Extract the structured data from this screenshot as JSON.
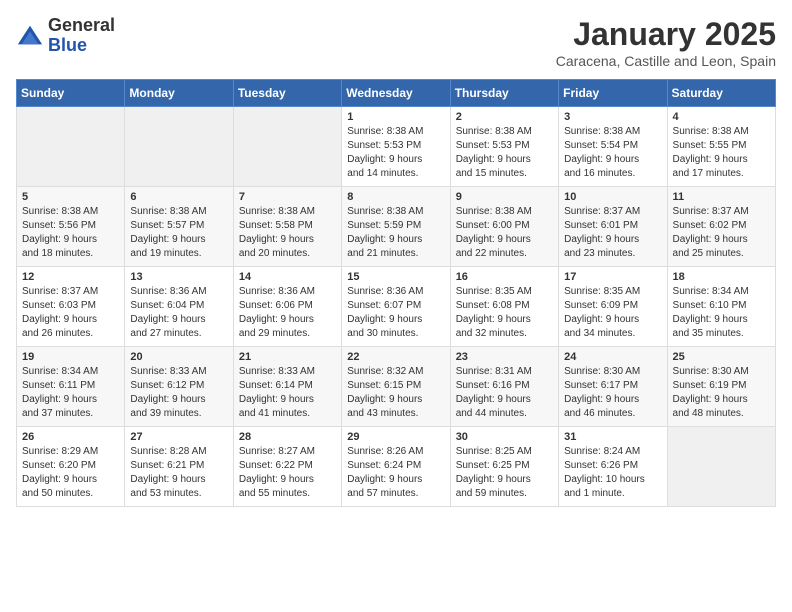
{
  "header": {
    "logo_general": "General",
    "logo_blue": "Blue",
    "month": "January 2025",
    "location": "Caracena, Castille and Leon, Spain"
  },
  "weekdays": [
    "Sunday",
    "Monday",
    "Tuesday",
    "Wednesday",
    "Thursday",
    "Friday",
    "Saturday"
  ],
  "weeks": [
    [
      {
        "day": "",
        "info": ""
      },
      {
        "day": "",
        "info": ""
      },
      {
        "day": "",
        "info": ""
      },
      {
        "day": "1",
        "info": "Sunrise: 8:38 AM\nSunset: 5:53 PM\nDaylight: 9 hours\nand 14 minutes."
      },
      {
        "day": "2",
        "info": "Sunrise: 8:38 AM\nSunset: 5:53 PM\nDaylight: 9 hours\nand 15 minutes."
      },
      {
        "day": "3",
        "info": "Sunrise: 8:38 AM\nSunset: 5:54 PM\nDaylight: 9 hours\nand 16 minutes."
      },
      {
        "day": "4",
        "info": "Sunrise: 8:38 AM\nSunset: 5:55 PM\nDaylight: 9 hours\nand 17 minutes."
      }
    ],
    [
      {
        "day": "5",
        "info": "Sunrise: 8:38 AM\nSunset: 5:56 PM\nDaylight: 9 hours\nand 18 minutes."
      },
      {
        "day": "6",
        "info": "Sunrise: 8:38 AM\nSunset: 5:57 PM\nDaylight: 9 hours\nand 19 minutes."
      },
      {
        "day": "7",
        "info": "Sunrise: 8:38 AM\nSunset: 5:58 PM\nDaylight: 9 hours\nand 20 minutes."
      },
      {
        "day": "8",
        "info": "Sunrise: 8:38 AM\nSunset: 5:59 PM\nDaylight: 9 hours\nand 21 minutes."
      },
      {
        "day": "9",
        "info": "Sunrise: 8:38 AM\nSunset: 6:00 PM\nDaylight: 9 hours\nand 22 minutes."
      },
      {
        "day": "10",
        "info": "Sunrise: 8:37 AM\nSunset: 6:01 PM\nDaylight: 9 hours\nand 23 minutes."
      },
      {
        "day": "11",
        "info": "Sunrise: 8:37 AM\nSunset: 6:02 PM\nDaylight: 9 hours\nand 25 minutes."
      }
    ],
    [
      {
        "day": "12",
        "info": "Sunrise: 8:37 AM\nSunset: 6:03 PM\nDaylight: 9 hours\nand 26 minutes."
      },
      {
        "day": "13",
        "info": "Sunrise: 8:36 AM\nSunset: 6:04 PM\nDaylight: 9 hours\nand 27 minutes."
      },
      {
        "day": "14",
        "info": "Sunrise: 8:36 AM\nSunset: 6:06 PM\nDaylight: 9 hours\nand 29 minutes."
      },
      {
        "day": "15",
        "info": "Sunrise: 8:36 AM\nSunset: 6:07 PM\nDaylight: 9 hours\nand 30 minutes."
      },
      {
        "day": "16",
        "info": "Sunrise: 8:35 AM\nSunset: 6:08 PM\nDaylight: 9 hours\nand 32 minutes."
      },
      {
        "day": "17",
        "info": "Sunrise: 8:35 AM\nSunset: 6:09 PM\nDaylight: 9 hours\nand 34 minutes."
      },
      {
        "day": "18",
        "info": "Sunrise: 8:34 AM\nSunset: 6:10 PM\nDaylight: 9 hours\nand 35 minutes."
      }
    ],
    [
      {
        "day": "19",
        "info": "Sunrise: 8:34 AM\nSunset: 6:11 PM\nDaylight: 9 hours\nand 37 minutes."
      },
      {
        "day": "20",
        "info": "Sunrise: 8:33 AM\nSunset: 6:12 PM\nDaylight: 9 hours\nand 39 minutes."
      },
      {
        "day": "21",
        "info": "Sunrise: 8:33 AM\nSunset: 6:14 PM\nDaylight: 9 hours\nand 41 minutes."
      },
      {
        "day": "22",
        "info": "Sunrise: 8:32 AM\nSunset: 6:15 PM\nDaylight: 9 hours\nand 43 minutes."
      },
      {
        "day": "23",
        "info": "Sunrise: 8:31 AM\nSunset: 6:16 PM\nDaylight: 9 hours\nand 44 minutes."
      },
      {
        "day": "24",
        "info": "Sunrise: 8:30 AM\nSunset: 6:17 PM\nDaylight: 9 hours\nand 46 minutes."
      },
      {
        "day": "25",
        "info": "Sunrise: 8:30 AM\nSunset: 6:19 PM\nDaylight: 9 hours\nand 48 minutes."
      }
    ],
    [
      {
        "day": "26",
        "info": "Sunrise: 8:29 AM\nSunset: 6:20 PM\nDaylight: 9 hours\nand 50 minutes."
      },
      {
        "day": "27",
        "info": "Sunrise: 8:28 AM\nSunset: 6:21 PM\nDaylight: 9 hours\nand 53 minutes."
      },
      {
        "day": "28",
        "info": "Sunrise: 8:27 AM\nSunset: 6:22 PM\nDaylight: 9 hours\nand 55 minutes."
      },
      {
        "day": "29",
        "info": "Sunrise: 8:26 AM\nSunset: 6:24 PM\nDaylight: 9 hours\nand 57 minutes."
      },
      {
        "day": "30",
        "info": "Sunrise: 8:25 AM\nSunset: 6:25 PM\nDaylight: 9 hours\nand 59 minutes."
      },
      {
        "day": "31",
        "info": "Sunrise: 8:24 AM\nSunset: 6:26 PM\nDaylight: 10 hours\nand 1 minute."
      },
      {
        "day": "",
        "info": ""
      }
    ]
  ]
}
